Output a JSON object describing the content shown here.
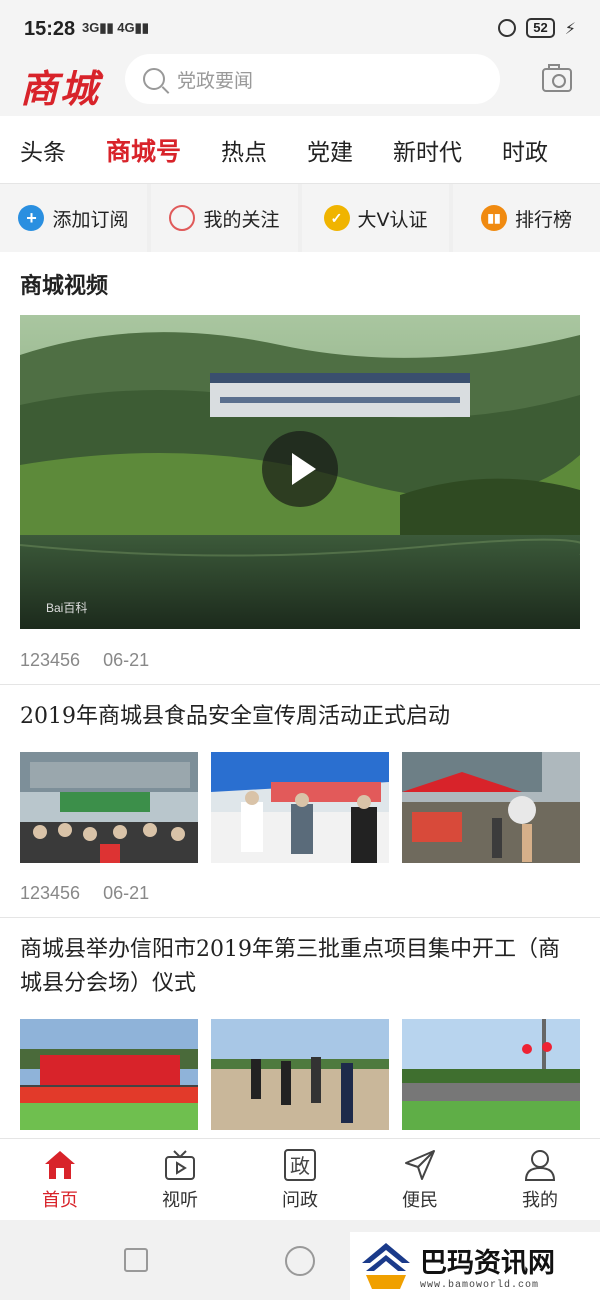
{
  "status_bar": {
    "time": "15:28",
    "signals": "3G▮▮ 4G▮▮",
    "battery": "52"
  },
  "header": {
    "logo": "商城",
    "search_placeholder": "党政要闻",
    "icons": [
      "search-icon",
      "camera-icon"
    ]
  },
  "tabs": [
    {
      "label": "头条",
      "active": false
    },
    {
      "label": "商城号",
      "active": true
    },
    {
      "label": "热点",
      "active": false
    },
    {
      "label": "党建",
      "active": false
    },
    {
      "label": "新时代",
      "active": false
    },
    {
      "label": "时政",
      "active": false
    }
  ],
  "actions": [
    {
      "label": "添加订阅",
      "icon": "plus-circle-icon",
      "icon_glyph": "+"
    },
    {
      "label": "我的关注",
      "icon": "circle-icon",
      "icon_glyph": ""
    },
    {
      "label": "大V认证",
      "icon": "v-badge-icon",
      "icon_glyph": "✓"
    },
    {
      "label": "排行榜",
      "icon": "ranking-icon",
      "icon_glyph": "▮▮"
    }
  ],
  "feed": {
    "video_section": {
      "title": "商城视频",
      "views": "123456",
      "date": "06-21",
      "watermark": "Bai百科"
    },
    "articles": [
      {
        "title": "2019年商城县食品安全宣传周活动正式启动",
        "views": "123456",
        "date": "06-21"
      },
      {
        "title": "商城县举办信阳市2019年第三批重点项目集中开工（商城县分会场）仪式"
      }
    ]
  },
  "bottom_nav": [
    {
      "label": "首页",
      "icon": "home-icon",
      "active": true
    },
    {
      "label": "视听",
      "icon": "tv-icon",
      "active": false
    },
    {
      "label": "问政",
      "icon": "zheng-icon",
      "active": false,
      "glyph": "政"
    },
    {
      "label": "便民",
      "icon": "paper-plane-icon",
      "active": false
    },
    {
      "label": "我的",
      "icon": "person-icon",
      "active": false
    }
  ],
  "watermark": {
    "text": "巴玛资讯网",
    "url": "www.bamoworld.com"
  },
  "colors": {
    "accent": "#d8232a",
    "link_blue": "#2a8fe0"
  }
}
